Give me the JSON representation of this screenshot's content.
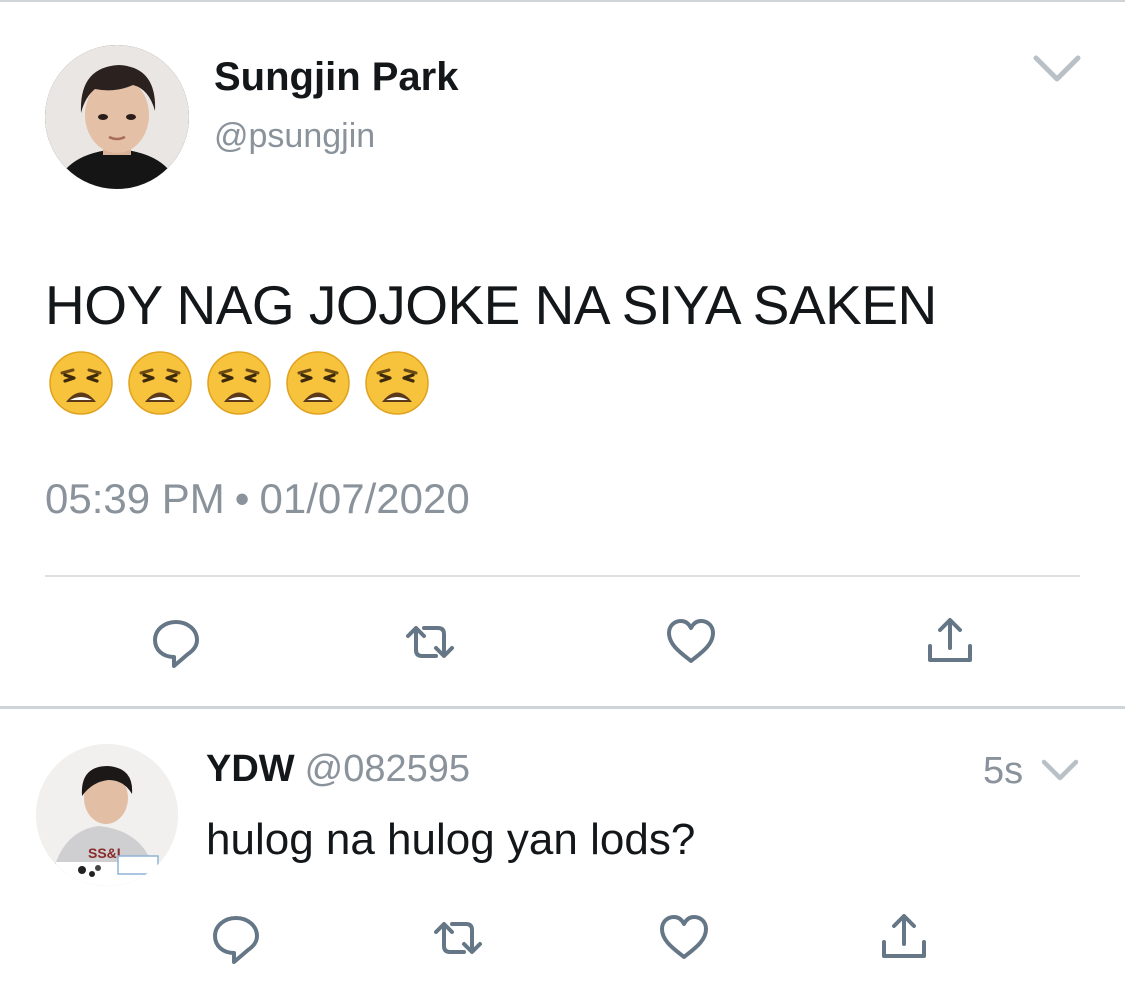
{
  "tweet": {
    "display_name": "Sungjin Park",
    "handle": "@psungjin",
    "text": "HOY NAG JOJOKE NA SIYA SAKEN",
    "emoji": "weary-face",
    "emoji_count": 5,
    "time": "05:39 PM",
    "separator": "•",
    "date": "01/07/2020",
    "actions": [
      "reply-icon",
      "retweet-icon",
      "like-icon",
      "share-icon"
    ]
  },
  "reply": {
    "display_name": "YDW",
    "handle": "@082595",
    "age": "5s",
    "text": "hulog na hulog yan lods?",
    "actions": [
      "reply-icon",
      "retweet-icon",
      "like-icon",
      "share-icon"
    ]
  },
  "colors": {
    "text": "#14171a",
    "secondary": "#8a939b",
    "icon": "#657786",
    "divider": "#dde1e4"
  }
}
